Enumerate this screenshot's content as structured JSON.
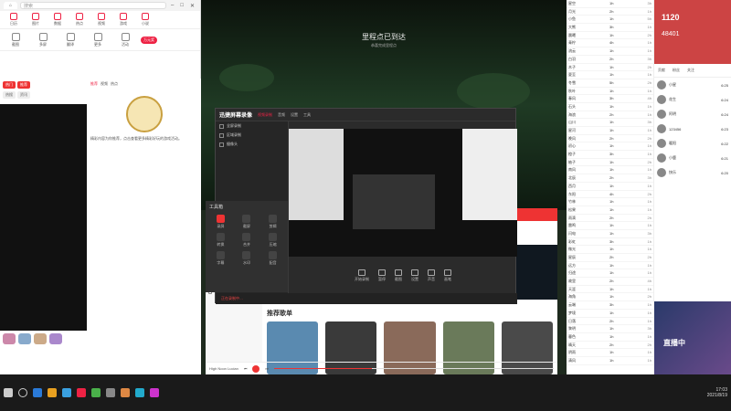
{
  "left_window": {
    "search_placeholder": "搜索",
    "tools": [
      "日历",
      "图片",
      "数据",
      "热点",
      "视频",
      "游戏",
      "小说"
    ],
    "tools2": [
      "截图",
      "多屏",
      "翻译",
      "更多",
      "活动"
    ],
    "badge": "万元奖",
    "chips": [
      "热门",
      "推荐"
    ],
    "grey_tags": [
      "热搜",
      "资讯"
    ],
    "content_tabs": [
      "推荐",
      "视频",
      "热点"
    ],
    "text": "精彩内容为你推荐，点击查看更多精彩好玩的游戏活动。",
    "emoji_labels": [
      "表情",
      "消息"
    ]
  },
  "main": {
    "title": "里程点已到达",
    "subtitle": "恭喜完成里程点"
  },
  "recorder": {
    "logo": "迅捷屏幕录像",
    "tabs": [
      "视频录制",
      "音频",
      "设置",
      "工具"
    ],
    "sources": [
      "全屏录制",
      "区域录制",
      "摄像头"
    ],
    "buttons": [
      "开始录制",
      "暂停",
      "截图",
      "设置",
      "声音",
      "画笔"
    ],
    "status": "正在录制中…",
    "tools_title": "工具箱",
    "tools": [
      "录屏",
      "截屏",
      "剪辑",
      "转换",
      "合并",
      "压缩",
      "字幕",
      "水印",
      "配音"
    ]
  },
  "music": {
    "side_items": [
      "发现音乐",
      "私人FM",
      "视频",
      "朋友",
      "我的收藏",
      "我的电台",
      "本地音乐",
      "下载管理"
    ],
    "recommend_title": "推荐歌单",
    "now_playing": "High Noon Lucian",
    "progress": 0.35,
    "album_colors": [
      "#5a8ab0",
      "#3a3a3a",
      "#8a6a5a",
      "#6a7a5a",
      "#4a4a4a"
    ]
  },
  "chat": [
    {
      "n": "星空",
      "v": "1h",
      "c": "3h"
    },
    {
      "n": "月光",
      "v": "2h",
      "c": "1h"
    },
    {
      "n": "小鱼",
      "v": "1h",
      "c": "5h"
    },
    {
      "n": "大熊",
      "v": "3h",
      "c": "1h"
    },
    {
      "n": "晨曦",
      "v": "1h",
      "c": "2h"
    },
    {
      "n": "青柠",
      "v": "4h",
      "c": "1h"
    },
    {
      "n": "流云",
      "v": "1h",
      "c": "1h"
    },
    {
      "n": "白羽",
      "v": "2h",
      "c": "3h"
    },
    {
      "n": "木子",
      "v": "1h",
      "c": "2h"
    },
    {
      "n": "夏至",
      "v": "1h",
      "c": "1h"
    },
    {
      "n": "冬雪",
      "v": "5h",
      "c": "2h"
    },
    {
      "n": "秋叶",
      "v": "1h",
      "c": "1h"
    },
    {
      "n": "春风",
      "v": "3h",
      "c": "4h"
    },
    {
      "n": "石头",
      "v": "1h",
      "c": "1h"
    },
    {
      "n": "海浪",
      "v": "2h",
      "c": "1h"
    },
    {
      "n": "山川",
      "v": "1h",
      "c": "3h"
    },
    {
      "n": "星河",
      "v": "1h",
      "c": "1h"
    },
    {
      "n": "晚风",
      "v": "2h",
      "c": "2h"
    },
    {
      "n": "初心",
      "v": "1h",
      "c": "1h"
    },
    {
      "n": "橙子",
      "v": "3h",
      "c": "1h"
    },
    {
      "n": "柚子",
      "v": "1h",
      "c": "2h"
    },
    {
      "n": "南风",
      "v": "1h",
      "c": "1h"
    },
    {
      "n": "北辰",
      "v": "2h",
      "c": "3h"
    },
    {
      "n": "西月",
      "v": "1h",
      "c": "1h"
    },
    {
      "n": "东阳",
      "v": "4h",
      "c": "2h"
    },
    {
      "n": "竹林",
      "v": "1h",
      "c": "1h"
    },
    {
      "n": "松果",
      "v": "1h",
      "c": "1h"
    },
    {
      "n": "雨滴",
      "v": "2h",
      "c": "2h"
    },
    {
      "n": "雷鸣",
      "v": "1h",
      "c": "1h"
    },
    {
      "n": "闪电",
      "v": "1h",
      "c": "3h"
    },
    {
      "n": "彩虹",
      "v": "3h",
      "c": "1h"
    },
    {
      "n": "微光",
      "v": "1h",
      "c": "1h"
    },
    {
      "n": "星辰",
      "v": "2h",
      "c": "2h"
    },
    {
      "n": "远方",
      "v": "1h",
      "c": "1h"
    },
    {
      "n": "归途",
      "v": "1h",
      "c": "1h"
    },
    {
      "n": "故里",
      "v": "2h",
      "c": "4h"
    },
    {
      "n": "天涯",
      "v": "1h",
      "c": "1h"
    },
    {
      "n": "海角",
      "v": "1h",
      "c": "2h"
    },
    {
      "n": "云端",
      "v": "3h",
      "c": "1h"
    },
    {
      "n": "梦境",
      "v": "1h",
      "c": "1h"
    },
    {
      "n": "日落",
      "v": "2h",
      "c": "1h"
    },
    {
      "n": "黎明",
      "v": "1h",
      "c": "3h"
    },
    {
      "n": "暮色",
      "v": "1h",
      "c": "1h"
    },
    {
      "n": "晴天",
      "v": "2h",
      "c": "2h"
    },
    {
      "n": "阴雨",
      "v": "1h",
      "c": "1h"
    },
    {
      "n": "清风",
      "v": "1h",
      "c": "1h"
    }
  ],
  "side": {
    "score": "1120",
    "n2": "48401",
    "tabs": [
      "贡献",
      "粉丝",
      "关注"
    ],
    "users": [
      {
        "name": "小星",
        "t": "6:25"
      },
      {
        "name": "花生",
        "t": "6:24"
      },
      {
        "name": "阿明",
        "t": "6:24"
      },
      {
        "name": "123456",
        "t": "6:23"
      },
      {
        "name": "暖阳",
        "t": "6:22"
      },
      {
        "name": "小鹿",
        "t": "6:21"
      },
      {
        "name": "快乐",
        "t": "6:20"
      }
    ],
    "live_text": "直播中"
  },
  "taskbar": {
    "time": "17:03",
    "date": "2021/8/19",
    "icons": [
      "#2a7ad8",
      "#e8a020",
      "#3aa0e0",
      "#e24",
      "#4ab04a",
      "#888",
      "#d84",
      "#2ac",
      "#c3c"
    ]
  }
}
